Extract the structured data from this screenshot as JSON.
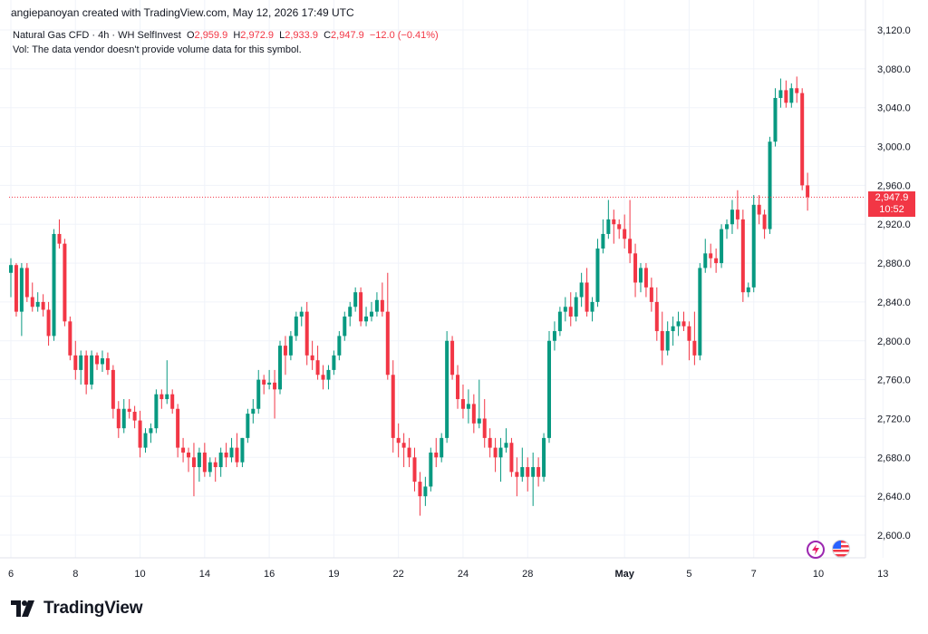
{
  "header": {
    "attribution": "angiepanoyan created with TradingView.com, May 12, 2026 17:49 UTC"
  },
  "legend": {
    "symbol": "Natural Gas CFD · 4h · WH SelfInvest",
    "open_label": "O",
    "open": "2,959.9",
    "high_label": "H",
    "high": "2,972.9",
    "low_label": "L",
    "low": "2,933.9",
    "close_label": "C",
    "close": "2,947.9",
    "change": "−12.0 (−0.41%)",
    "vol_note": "Vol: The data vendor doesn't provide volume data for this symbol."
  },
  "price_badge": {
    "price": "2,947.9",
    "countdown": "10:52"
  },
  "logo": {
    "text": "TradingView"
  },
  "colors": {
    "up": "#089981",
    "down": "#f23645",
    "grid": "#f0f3fa",
    "text": "#131722"
  },
  "icons": [
    "lightning-icon",
    "us-flag-icon"
  ],
  "chart_data": {
    "type": "candlestick",
    "timeframe": "4h",
    "ylim": [
      2580,
      3140
    ],
    "y_ticks": [
      "3,120.0",
      "3,080.0",
      "3,040.0",
      "3,000.0",
      "2,960.0",
      "2,920.0",
      "2,880.0",
      "2,840.0",
      "2,800.0",
      "2,760.0",
      "2,720.0",
      "2,680.0",
      "2,640.0",
      "2,600.0"
    ],
    "y_tick_values": [
      3120,
      3080,
      3040,
      3000,
      2960,
      2920,
      2880,
      2840,
      2800,
      2760,
      2720,
      2680,
      2640,
      2600
    ],
    "x_ticks": [
      {
        "label": "6",
        "bar": 0
      },
      {
        "label": "8",
        "bar": 12
      },
      {
        "label": "10",
        "bar": 24
      },
      {
        "label": "14",
        "bar": 36
      },
      {
        "label": "16",
        "bar": 48
      },
      {
        "label": "19",
        "bar": 60
      },
      {
        "label": "22",
        "bar": 72
      },
      {
        "label": "24",
        "bar": 84
      },
      {
        "label": "28",
        "bar": 96
      },
      {
        "label": "May",
        "bar": 114
      },
      {
        "label": "5",
        "bar": 126
      },
      {
        "label": "7",
        "bar": 138
      },
      {
        "label": "10",
        "bar": 150
      },
      {
        "label": "13",
        "bar": 162
      }
    ],
    "last_price": 2947.9,
    "candles": [
      [
        2870,
        2885,
        2845,
        2878
      ],
      [
        2878,
        2880,
        2825,
        2830
      ],
      [
        2830,
        2880,
        2805,
        2875
      ],
      [
        2875,
        2880,
        2840,
        2845
      ],
      [
        2845,
        2860,
        2830,
        2835
      ],
      [
        2835,
        2850,
        2830,
        2840
      ],
      [
        2840,
        2848,
        2825,
        2832
      ],
      [
        2832,
        2840,
        2795,
        2805
      ],
      [
        2805,
        2915,
        2800,
        2910
      ],
      [
        2910,
        2925,
        2895,
        2900
      ],
      [
        2900,
        2905,
        2815,
        2820
      ],
      [
        2820,
        2825,
        2780,
        2785
      ],
      [
        2785,
        2800,
        2760,
        2770
      ],
      [
        2770,
        2790,
        2755,
        2785
      ],
      [
        2785,
        2790,
        2745,
        2755
      ],
      [
        2755,
        2790,
        2750,
        2785
      ],
      [
        2785,
        2788,
        2770,
        2776
      ],
      [
        2776,
        2790,
        2768,
        2782
      ],
      [
        2782,
        2788,
        2765,
        2770
      ],
      [
        2770,
        2775,
        2720,
        2730
      ],
      [
        2730,
        2738,
        2700,
        2710
      ],
      [
        2710,
        2740,
        2705,
        2730
      ],
      [
        2730,
        2740,
        2720,
        2727
      ],
      [
        2727,
        2733,
        2710,
        2718
      ],
      [
        2718,
        2728,
        2680,
        2690
      ],
      [
        2690,
        2710,
        2685,
        2705
      ],
      [
        2705,
        2715,
        2695,
        2710
      ],
      [
        2710,
        2750,
        2705,
        2745
      ],
      [
        2745,
        2750,
        2730,
        2740
      ],
      [
        2740,
        2780,
        2735,
        2745
      ],
      [
        2745,
        2750,
        2725,
        2730
      ],
      [
        2730,
        2735,
        2680,
        2690
      ],
      [
        2690,
        2700,
        2675,
        2685
      ],
      [
        2685,
        2690,
        2665,
        2680
      ],
      [
        2680,
        2695,
        2640,
        2670
      ],
      [
        2670,
        2690,
        2655,
        2685
      ],
      [
        2685,
        2695,
        2660,
        2665
      ],
      [
        2665,
        2680,
        2660,
        2675
      ],
      [
        2675,
        2680,
        2655,
        2670
      ],
      [
        2670,
        2690,
        2660,
        2685
      ],
      [
        2685,
        2695,
        2670,
        2680
      ],
      [
        2680,
        2700,
        2675,
        2690
      ],
      [
        2690,
        2705,
        2670,
        2675
      ],
      [
        2675,
        2700,
        2670,
        2700
      ],
      [
        2700,
        2730,
        2695,
        2725
      ],
      [
        2725,
        2740,
        2715,
        2730
      ],
      [
        2730,
        2770,
        2725,
        2760
      ],
      [
        2760,
        2765,
        2745,
        2755
      ],
      [
        2755,
        2770,
        2750,
        2757
      ],
      [
        2757,
        2770,
        2720,
        2750
      ],
      [
        2750,
        2800,
        2745,
        2795
      ],
      [
        2795,
        2805,
        2765,
        2785
      ],
      [
        2785,
        2810,
        2780,
        2805
      ],
      [
        2805,
        2830,
        2800,
        2825
      ],
      [
        2825,
        2835,
        2815,
        2830
      ],
      [
        2830,
        2840,
        2775,
        2785
      ],
      [
        2785,
        2800,
        2770,
        2780
      ],
      [
        2780,
        2795,
        2760,
        2765
      ],
      [
        2765,
        2775,
        2750,
        2760
      ],
      [
        2760,
        2775,
        2750,
        2770
      ],
      [
        2770,
        2790,
        2765,
        2785
      ],
      [
        2785,
        2810,
        2780,
        2805
      ],
      [
        2805,
        2830,
        2800,
        2825
      ],
      [
        2825,
        2840,
        2815,
        2835
      ],
      [
        2835,
        2855,
        2830,
        2850
      ],
      [
        2850,
        2855,
        2815,
        2820
      ],
      [
        2820,
        2835,
        2815,
        2825
      ],
      [
        2825,
        2840,
        2820,
        2830
      ],
      [
        2830,
        2850,
        2825,
        2842
      ],
      [
        2842,
        2860,
        2825,
        2830
      ],
      [
        2830,
        2870,
        2760,
        2765
      ],
      [
        2765,
        2780,
        2685,
        2700
      ],
      [
        2700,
        2715,
        2680,
        2695
      ],
      [
        2695,
        2705,
        2670,
        2690
      ],
      [
        2690,
        2700,
        2670,
        2680
      ],
      [
        2680,
        2690,
        2645,
        2655
      ],
      [
        2655,
        2665,
        2620,
        2640
      ],
      [
        2640,
        2660,
        2630,
        2650
      ],
      [
        2650,
        2690,
        2645,
        2685
      ],
      [
        2685,
        2700,
        2670,
        2680
      ],
      [
        2680,
        2705,
        2675,
        2700
      ],
      [
        2700,
        2810,
        2695,
        2800
      ],
      [
        2800,
        2805,
        2760,
        2765
      ],
      [
        2765,
        2775,
        2730,
        2740
      ],
      [
        2740,
        2755,
        2720,
        2730
      ],
      [
        2730,
        2750,
        2715,
        2735
      ],
      [
        2735,
        2745,
        2705,
        2715
      ],
      [
        2715,
        2760,
        2710,
        2720
      ],
      [
        2720,
        2740,
        2690,
        2700
      ],
      [
        2700,
        2710,
        2680,
        2690
      ],
      [
        2690,
        2700,
        2665,
        2680
      ],
      [
        2680,
        2700,
        2655,
        2690
      ],
      [
        2690,
        2710,
        2685,
        2695
      ],
      [
        2695,
        2700,
        2660,
        2665
      ],
      [
        2665,
        2680,
        2640,
        2660
      ],
      [
        2660,
        2690,
        2655,
        2670
      ],
      [
        2670,
        2680,
        2645,
        2660
      ],
      [
        2660,
        2685,
        2630,
        2670
      ],
      [
        2670,
        2680,
        2650,
        2660
      ],
      [
        2660,
        2705,
        2655,
        2700
      ],
      [
        2700,
        2810,
        2695,
        2800
      ],
      [
        2800,
        2820,
        2790,
        2810
      ],
      [
        2810,
        2835,
        2805,
        2830
      ],
      [
        2830,
        2845,
        2820,
        2835
      ],
      [
        2835,
        2850,
        2815,
        2825
      ],
      [
        2825,
        2850,
        2820,
        2845
      ],
      [
        2845,
        2870,
        2835,
        2860
      ],
      [
        2860,
        2875,
        2825,
        2830
      ],
      [
        2830,
        2845,
        2820,
        2840
      ],
      [
        2840,
        2905,
        2835,
        2895
      ],
      [
        2895,
        2925,
        2890,
        2910
      ],
      [
        2910,
        2945,
        2905,
        2925
      ],
      [
        2925,
        2935,
        2900,
        2920
      ],
      [
        2920,
        2925,
        2905,
        2915
      ],
      [
        2915,
        2930,
        2895,
        2905
      ],
      [
        2905,
        2945,
        2880,
        2890
      ],
      [
        2890,
        2900,
        2845,
        2860
      ],
      [
        2860,
        2880,
        2850,
        2875
      ],
      [
        2875,
        2880,
        2845,
        2855
      ],
      [
        2855,
        2865,
        2830,
        2840
      ],
      [
        2840,
        2855,
        2800,
        2810
      ],
      [
        2810,
        2830,
        2775,
        2790
      ],
      [
        2790,
        2820,
        2785,
        2810
      ],
      [
        2810,
        2825,
        2795,
        2815
      ],
      [
        2815,
        2830,
        2805,
        2820
      ],
      [
        2820,
        2830,
        2810,
        2815
      ],
      [
        2815,
        2820,
        2780,
        2800
      ],
      [
        2800,
        2830,
        2775,
        2785
      ],
      [
        2785,
        2880,
        2780,
        2875
      ],
      [
        2875,
        2905,
        2870,
        2890
      ],
      [
        2890,
        2900,
        2875,
        2885
      ],
      [
        2885,
        2895,
        2870,
        2880
      ],
      [
        2880,
        2920,
        2875,
        2915
      ],
      [
        2915,
        2925,
        2905,
        2920
      ],
      [
        2920,
        2945,
        2910,
        2935
      ],
      [
        2935,
        2955,
        2915,
        2925
      ],
      [
        2925,
        2935,
        2840,
        2850
      ],
      [
        2850,
        2860,
        2845,
        2855
      ],
      [
        2855,
        2950,
        2850,
        2940
      ],
      [
        2940,
        2950,
        2920,
        2930
      ],
      [
        2930,
        2935,
        2905,
        2915
      ],
      [
        2915,
        3010,
        2910,
        3005
      ],
      [
        3005,
        3060,
        3000,
        3050
      ],
      [
        3050,
        3070,
        3040,
        3058
      ],
      [
        3058,
        3068,
        3040,
        3045
      ],
      [
        3045,
        3065,
        3040,
        3060
      ],
      [
        3060,
        3072,
        3045,
        3055
      ],
      [
        3055,
        3060,
        2955,
        2960
      ],
      [
        2960,
        2973,
        2934,
        2948
      ]
    ]
  }
}
